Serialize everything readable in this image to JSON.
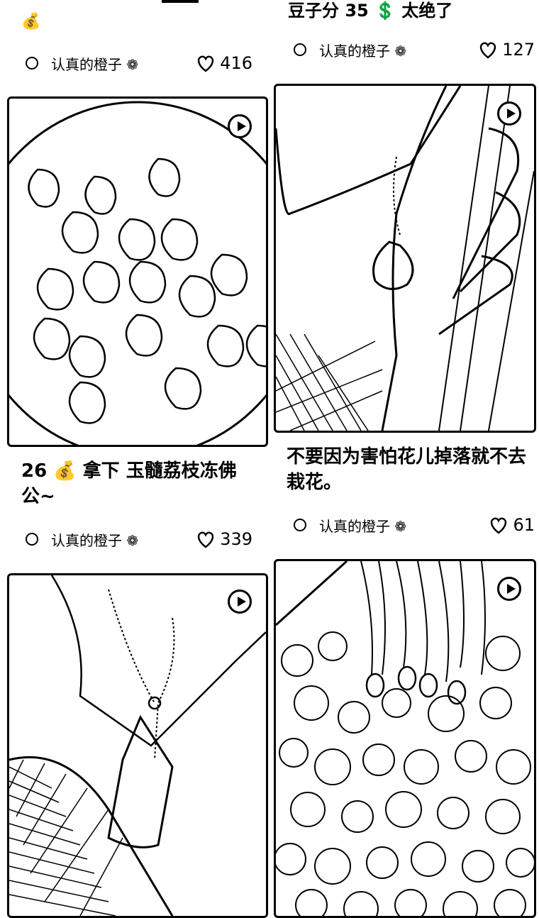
{
  "cards": [
    {
      "id": "c1",
      "title_fragment": "💰",
      "author": "认真的橙子",
      "likes": "416"
    },
    {
      "id": "c2",
      "title_fragment": "豆子分 35 💲 太绝了",
      "author": "认真的橙子",
      "likes": "127"
    },
    {
      "id": "c3",
      "title": "26 💰 拿下 玉髓荔枝冻佛公~",
      "author": "认真的橙子",
      "likes": "339"
    },
    {
      "id": "c4",
      "title": "不要因为害怕花儿掉落就不去栽花。",
      "author": "认真的橙子",
      "likes": "61"
    },
    {
      "id": "c5",
      "title": "",
      "author": "",
      "likes": ""
    },
    {
      "id": "c6",
      "title": "",
      "author": "",
      "likes": ""
    }
  ],
  "author_suffix_icon": "fire-icon",
  "like_icon": "heart-icon",
  "video_icon": "play-icon"
}
